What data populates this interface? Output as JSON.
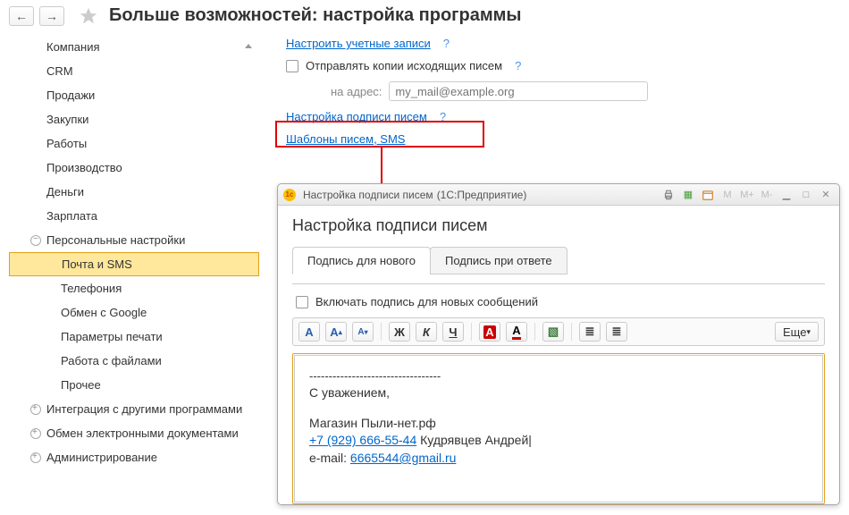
{
  "header": {
    "title": "Больше возможностей: настройка программы"
  },
  "sidebar": {
    "items": [
      {
        "label": "Компания"
      },
      {
        "label": "CRM"
      },
      {
        "label": "Продажи"
      },
      {
        "label": "Закупки"
      },
      {
        "label": "Работы"
      },
      {
        "label": "Производство"
      },
      {
        "label": "Деньги"
      },
      {
        "label": "Зарплата"
      },
      {
        "label": "Персональные настройки"
      },
      {
        "label": "Почта и SMS"
      },
      {
        "label": "Телефония"
      },
      {
        "label": "Обмен с Google"
      },
      {
        "label": "Параметры печати"
      },
      {
        "label": "Работа с файлами"
      },
      {
        "label": "Прочее"
      },
      {
        "label": "Интеграция с другими программами"
      },
      {
        "label": "Обмен электронными документами"
      },
      {
        "label": "Администрирование"
      }
    ]
  },
  "main": {
    "configure_accounts": "Настроить учетные записи",
    "send_copies_label": "Отправлять копии исходящих писем",
    "addr_label": "на адрес:",
    "addr_placeholder": "my_mail@example.org",
    "signature_link": "Настройка подписи писем",
    "templates_link": "Шаблоны писем, SMS"
  },
  "dialog": {
    "title_main": "Настройка подписи писем",
    "title_suffix": "(1С:Предприятие)",
    "heading": "Настройка подписи писем",
    "tabs": [
      {
        "label": "Подпись для нового"
      },
      {
        "label": "Подпись при ответе"
      }
    ],
    "include_sig_label": "Включать подпись для новых сообщений",
    "toolbar": {
      "font": "A",
      "size_up": "A",
      "size_dn": "A",
      "bold": "Ж",
      "italic": "К",
      "underline": "Ч",
      "bgcolor": "A",
      "fgcolor": "A",
      "image": "▧",
      "list_ul": "≣",
      "list_ol": "≣",
      "more": "Еще",
      "more_arrow": "▾"
    },
    "editor": {
      "sep": "----------------------------------",
      "regards": "С уважением,",
      "company": "Магазин Пыли-нет.рф",
      "phone": "+7 (929) 666-55-44",
      "name": "Кудрявцев Андрей",
      "email_label": "e-mail:",
      "email": "6665544@gmail.ru"
    },
    "titlebar_tools": {
      "m": "M",
      "m_plus": "M+",
      "m_minus": "M-"
    }
  }
}
